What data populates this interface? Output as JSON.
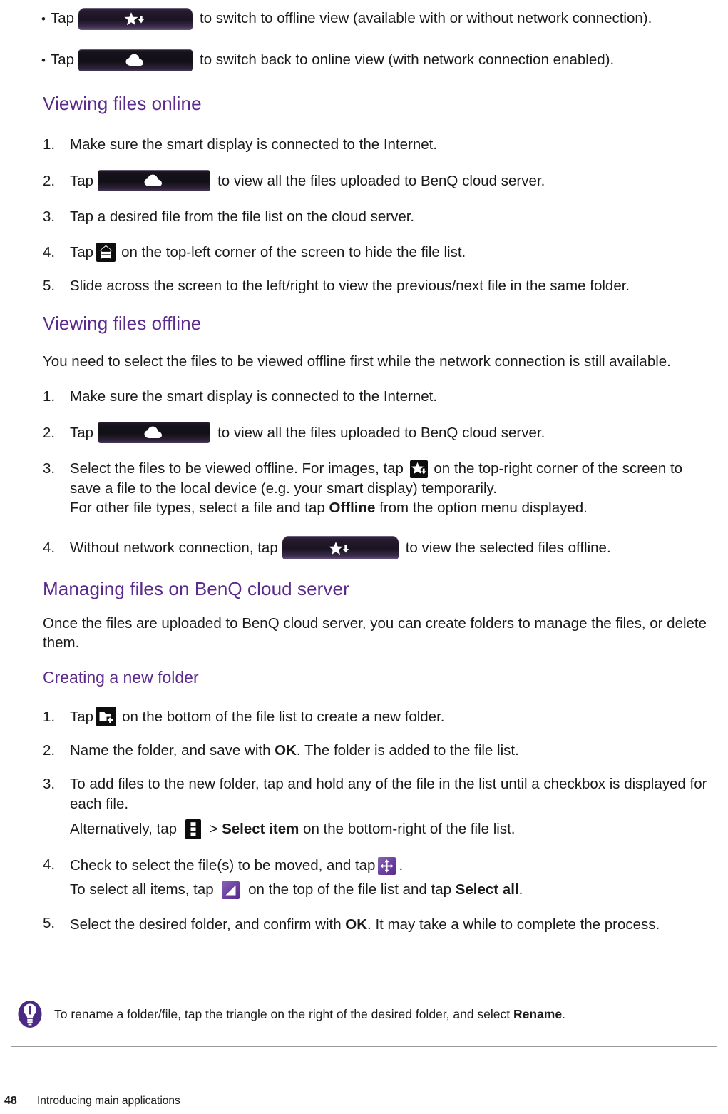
{
  "page": {
    "number": "48",
    "chapter": "Introducing main applications"
  },
  "bullets": [
    {
      "marker": "•",
      "lead": "Tap",
      "button": "offline-view-button",
      "tail": "to switch to offline view (available with or without network connection)."
    },
    {
      "marker": "•",
      "lead": "Tap",
      "button": "online-view-button",
      "tail": "to switch back to online view (with network connection enabled)."
    }
  ],
  "sections": [
    {
      "id": "viewing-files-online",
      "heading": "Viewing files online",
      "steps": [
        {
          "num": "1.",
          "text": "Make sure the smart display is connected to the Internet."
        },
        {
          "num": "2.",
          "lead": "Tap",
          "button": "cloud-button",
          "tail": "to view all the files uploaded to BenQ cloud server."
        },
        {
          "num": "3.",
          "text": "Tap a desired file from the file list on the cloud server."
        },
        {
          "num": "4.",
          "lead": "Tap",
          "icon": "hide-file-list-icon",
          "tail": "on the top-left corner of the screen to hide the file list."
        },
        {
          "num": "5.",
          "text": "Slide across the screen to the left/right to view the previous/next file in the same folder."
        }
      ]
    },
    {
      "id": "viewing-files-offline",
      "heading": "Viewing files offline",
      "intro": "You need to select the files to be viewed offline first while the network connection is still available.",
      "steps": [
        {
          "num": "1.",
          "text": "Make sure the smart display is connected to the Internet."
        },
        {
          "num": "2.",
          "lead": "Tap",
          "button": "cloud-button",
          "tail": "to view all the files uploaded to BenQ cloud server."
        },
        {
          "num": "3.",
          "lead": "Select the files to be viewed offline. For images, tap",
          "icon": "star-download-icon",
          "tail": "on the top-right corner of the screen to save a file to the local device (e.g. your smart display) temporarily.",
          "line2_pre": "For other file types, select a file and tap ",
          "line2_bold": "Offline",
          "line2_post": " from the option menu displayed."
        },
        {
          "num": "4.",
          "lead": "Without network connection, tap",
          "button": "offline-view-button",
          "tail": "to view the selected files offline."
        }
      ]
    }
  ],
  "managing": {
    "heading": "Managing files on BenQ cloud server",
    "intro": "Once the files are uploaded to BenQ cloud server, you can create folders to manage the files, or delete them.",
    "subheading": "Creating a new folder",
    "steps": [
      {
        "num": "1.",
        "lead": "Tap",
        "icon": "new-folder-icon",
        "tail": "on the bottom of the file list to create a new folder."
      },
      {
        "num": "2.",
        "pre": "Name the folder, and save with ",
        "bold": "OK",
        "post": ". The folder is added to the file list."
      },
      {
        "num": "3.",
        "text": "To add files to the new folder, tap and hold any of the file in the list until a checkbox is displayed for each file.",
        "line2_pre": "Alternatively, tap",
        "icon": "overflow-menu-icon",
        "line2_mid": "> ",
        "line2_bold": "Select item",
        "line2_post": " on the bottom-right of the file list."
      },
      {
        "num": "4.",
        "lead": "Check to select the file(s) to be moved, and tap",
        "icon": "move-icon",
        "tail": ".",
        "line2_pre": "To select all items, tap",
        "icon2": "select-all-triangle-icon",
        "line2_mid": "on the top of the file list and tap ",
        "line2_bold": "Select all",
        "line2_post": "."
      },
      {
        "num": "5.",
        "pre": "Select the desired folder, and confirm with ",
        "bold": "OK",
        "post": ". It may take a while to complete the process."
      }
    ]
  },
  "note": {
    "icon": "lightbulb-tip-icon",
    "pre": "To rename a folder/file, tap the triangle on the right of the desired folder, and select ",
    "bold": "Rename",
    "post": "."
  },
  "colors": {
    "heading_purple": "#5b2a8c",
    "icon_purple": "#6a3f9e",
    "button_dark": "#16121c",
    "text": "#1a1a1a",
    "rule": "#9a9a9a"
  }
}
